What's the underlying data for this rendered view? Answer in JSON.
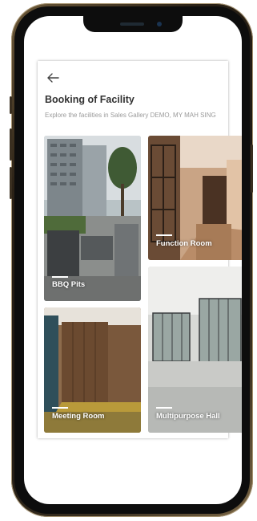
{
  "screen": {
    "title": "Booking of Facility",
    "subtitle": "Explore the facilities in Sales Gallery DEMO, MY MAH SING"
  },
  "icons": {
    "back": "arrow-left-icon"
  },
  "facilities": [
    {
      "label": "BBQ Pits"
    },
    {
      "label": "Function Room"
    },
    {
      "label": "Meeting Room"
    },
    {
      "label": "Multipurpose Hall"
    }
  ]
}
